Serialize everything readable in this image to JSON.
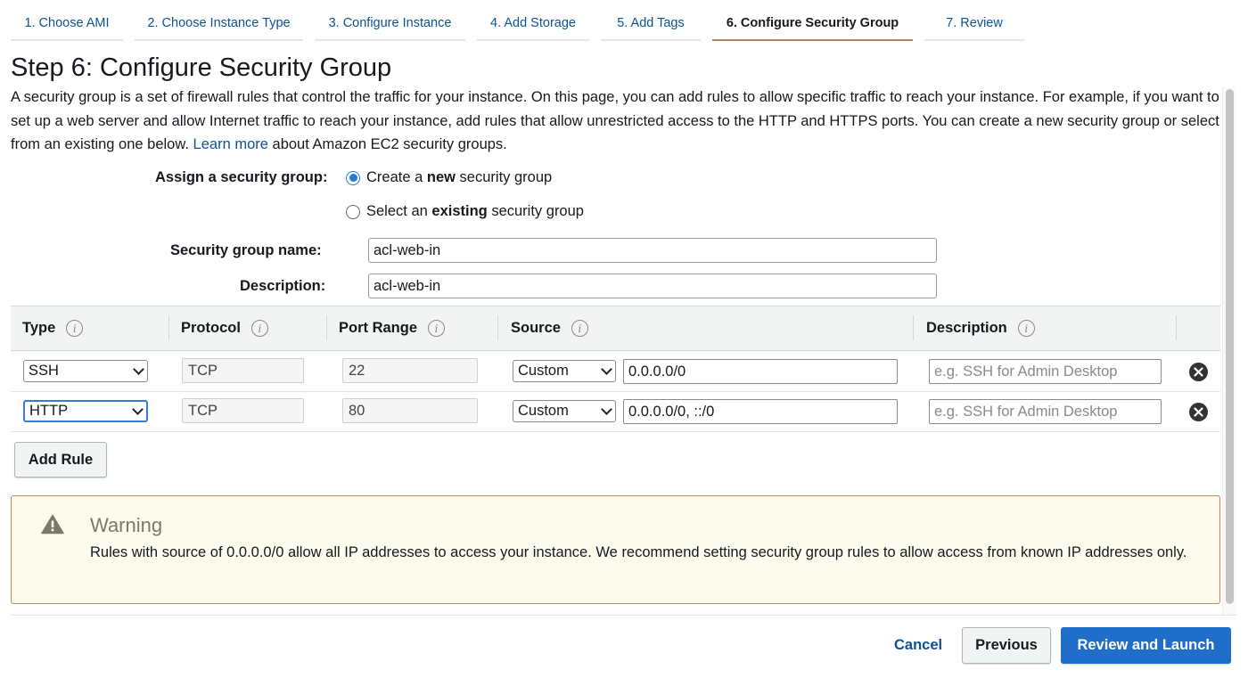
{
  "wizard": {
    "tabs": [
      {
        "label": "1. Choose AMI"
      },
      {
        "label": "2. Choose Instance Type"
      },
      {
        "label": "3. Configure Instance"
      },
      {
        "label": "4. Add Storage"
      },
      {
        "label": "5. Add Tags"
      },
      {
        "label": "6. Configure Security Group",
        "active": true
      },
      {
        "label": "7. Review"
      }
    ]
  },
  "page": {
    "title": "Step 6: Configure Security Group",
    "intro_before_link": "A security group is a set of firewall rules that control the traffic for your instance. On this page, you can add rules to allow specific traffic to reach your instance. For example, if you want to set up a web server and allow Internet traffic to reach your instance, add rules that allow unrestricted access to the HTTP and HTTPS ports. You can create a new security group or select from an existing one below.",
    "learn_more": "Learn more",
    "intro_after_link": "about Amazon EC2 security groups."
  },
  "assign": {
    "label": "Assign a security group:",
    "options": [
      {
        "pre": "Create a ",
        "bold": "new",
        "post": " security group",
        "checked": true
      },
      {
        "pre": "Select an ",
        "bold": "existing",
        "post": " security group",
        "checked": false
      }
    ]
  },
  "form": {
    "name_label": "Security group name:",
    "name_value": "acl-web-in",
    "description_label": "Description:",
    "description_value": "acl-web-in"
  },
  "table": {
    "headers": {
      "type": "Type",
      "protocol": "Protocol",
      "port_range": "Port Range",
      "source": "Source",
      "description": "Description"
    },
    "rows": [
      {
        "type": "SSH",
        "protocol": "TCP",
        "port_range": "22",
        "source_mode": "Custom",
        "source_cidr": "0.0.0.0/0",
        "description_placeholder": "e.g. SSH for Admin Desktop"
      },
      {
        "type": "HTTP",
        "protocol": "TCP",
        "port_range": "80",
        "source_mode": "Custom",
        "source_cidr": "0.0.0.0/0, ::/0",
        "description_placeholder": "e.g. SSH for Admin Desktop"
      }
    ],
    "add_rule": "Add Rule"
  },
  "warning": {
    "title": "Warning",
    "body": "Rules with source of 0.0.0.0/0 allow all IP addresses to access your instance. We recommend setting security group rules to allow access from known IP addresses only."
  },
  "footer": {
    "cancel": "Cancel",
    "previous": "Previous",
    "review": "Review and Launch"
  },
  "colors": {
    "link": "#0b5394",
    "primary_button": "#1f6ec9",
    "active_tab_underline": "#b7845a",
    "warning_border": "#c28a5d",
    "warning_bg": "#fcfbee"
  },
  "icons": {
    "info": "info-icon",
    "remove": "remove-rule-icon",
    "warning": "warning-icon"
  }
}
